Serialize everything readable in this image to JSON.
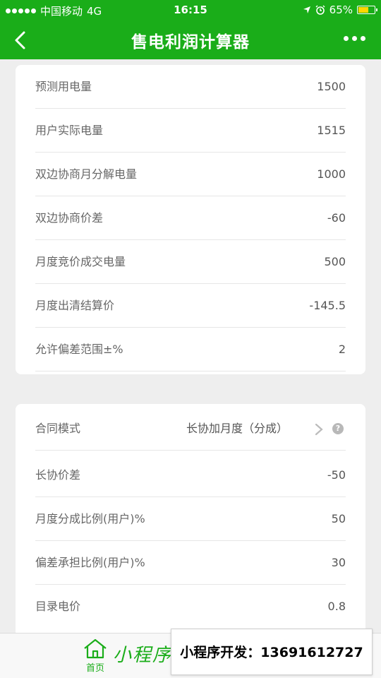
{
  "status": {
    "carrier": "中国移动",
    "network": "4G",
    "time": "16:15",
    "battery": "65%",
    "battery_level": 0.65
  },
  "nav": {
    "title": "售电利润计算器"
  },
  "card1": {
    "rows": [
      {
        "label": "预测用电量",
        "value": "1500"
      },
      {
        "label": "用户实际电量",
        "value": "1515"
      },
      {
        "label": "双边协商月分解电量",
        "value": "1000"
      },
      {
        "label": "双边协商价差",
        "value": "-60"
      },
      {
        "label": "月度竞价成交电量",
        "value": "500"
      },
      {
        "label": "月度出清结算价",
        "value": "-145.5"
      },
      {
        "label": "允许偏差范围±%",
        "value": "2"
      }
    ]
  },
  "card2": {
    "contract": {
      "label": "合同模式",
      "value": "长协加月度（分成）"
    },
    "rows": [
      {
        "label": "长协价差",
        "value": "-50"
      },
      {
        "label": "月度分成比例(用户)%",
        "value": "50"
      },
      {
        "label": "偏差承担比例(用户)%",
        "value": "30"
      },
      {
        "label": "目录电价",
        "value": "0.8"
      }
    ]
  },
  "tabbar": {
    "home_label": "首页",
    "watermark": "小程序"
  },
  "ad": {
    "text": "小程序开发：13691612727"
  },
  "colors": {
    "brand": "#1aad19",
    "background": "#eeeeee"
  }
}
